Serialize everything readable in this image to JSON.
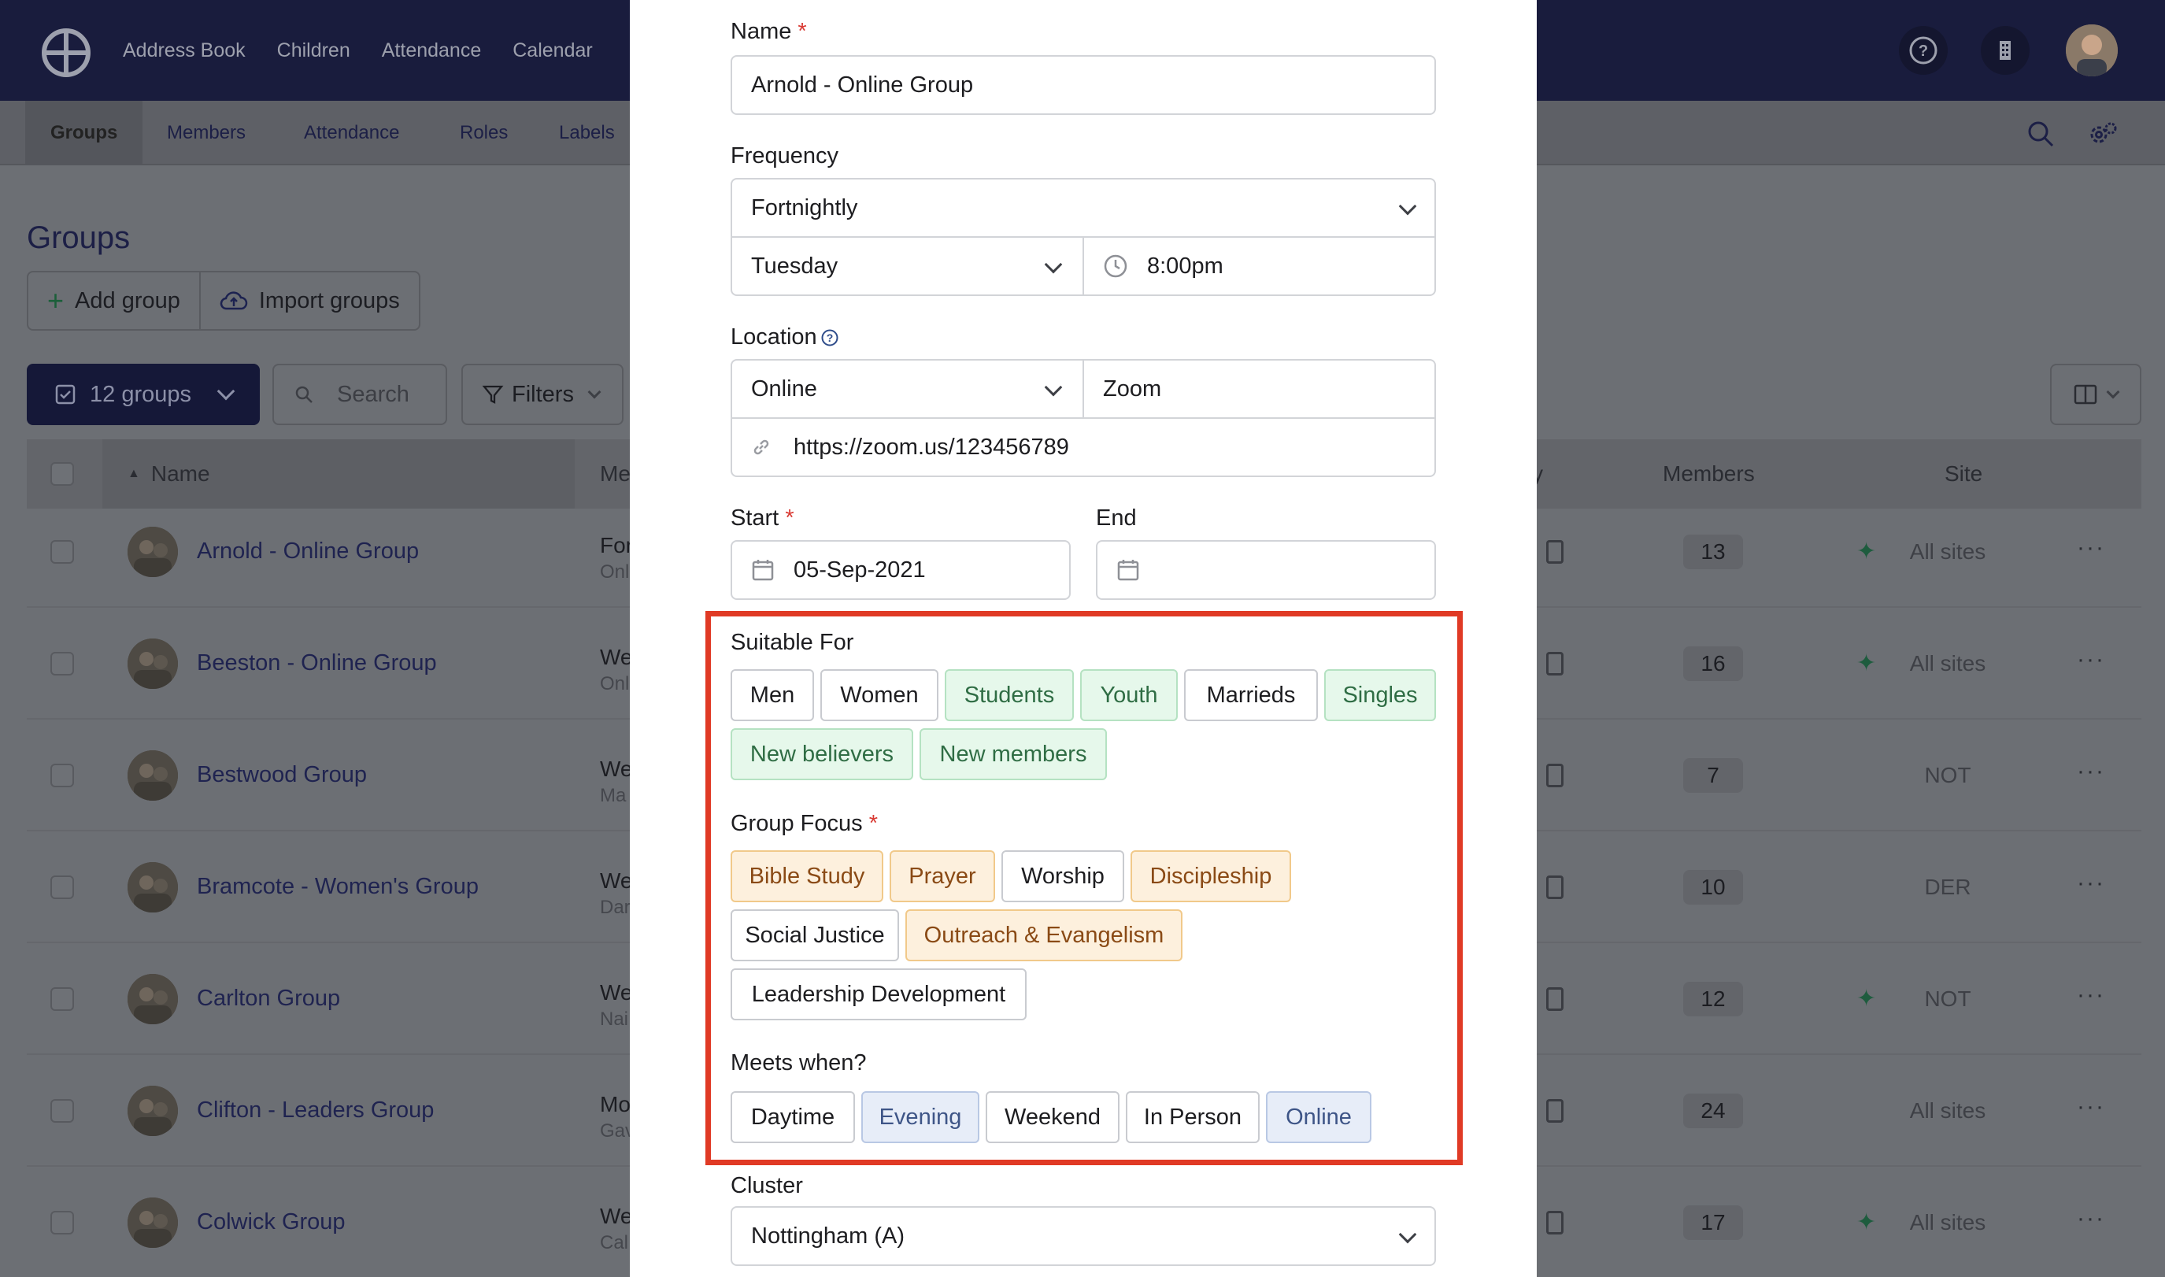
{
  "topnav": {
    "items": [
      "Address Book",
      "Children",
      "Attendance",
      "Calendar"
    ]
  },
  "subnav": {
    "tabs": [
      "Groups",
      "Members",
      "Attendance",
      "Roles",
      "Labels"
    ]
  },
  "page": {
    "title": "Groups",
    "add_group": "Add group",
    "import_groups": "Import groups",
    "groups_count": "12 groups",
    "search_placeholder": "Search",
    "filters": "Filters"
  },
  "table": {
    "headers": {
      "name": "Name",
      "meets": "Me",
      "activity": "y",
      "members": "Members",
      "site": "Site"
    },
    "rows": [
      {
        "name": "Arnold - Online Group",
        "meet1": "For",
        "meet2": "Onl",
        "members": "13",
        "site": "All sites",
        "spark": true
      },
      {
        "name": "Beeston - Online Group",
        "meet1": "We",
        "meet2": "Onl",
        "members": "16",
        "site": "All sites",
        "spark": true
      },
      {
        "name": "Bestwood Group",
        "meet1": "We",
        "meet2": "Ma",
        "members": "7",
        "site": "NOT",
        "spark": false
      },
      {
        "name": "Bramcote - Women's Group",
        "meet1": "We",
        "meet2": "Dar",
        "members": "10",
        "site": "DER",
        "spark": false
      },
      {
        "name": "Carlton Group",
        "meet1": "We",
        "meet2": "Nai",
        "members": "12",
        "site": "NOT",
        "spark": true
      },
      {
        "name": "Clifton - Leaders Group",
        "meet1": "Mo",
        "meet2": "Gav",
        "members": "24",
        "site": "All sites",
        "spark": false
      },
      {
        "name": "Colwick Group",
        "meet1": "We",
        "meet2": "Cal",
        "members": "17",
        "site": "All sites",
        "spark": true
      }
    ],
    "dots": "···"
  },
  "form": {
    "name_label": "Name",
    "name_value": "Arnold - Online Group",
    "frequency_label": "Frequency",
    "frequency_value": "Fortnightly",
    "day_value": "Tuesday",
    "time_value": "8:00pm",
    "location_label": "Location",
    "location_type": "Online",
    "location_platform": "Zoom",
    "location_url": "https://zoom.us/123456789",
    "start_label": "Start",
    "start_value": "05-Sep-2021",
    "end_label": "End",
    "end_value": "",
    "required_mark": "*",
    "suitable_label": "Suitable For",
    "suitable": [
      "Men",
      "Women",
      "Students",
      "Youth",
      "Marrieds",
      "Singles",
      "New believers",
      "New members"
    ],
    "focus_label": "Group Focus",
    "focus": [
      "Bible Study",
      "Prayer",
      "Worship",
      "Discipleship",
      "Social Justice",
      "Outreach & Evangelism",
      "Leadership Development"
    ],
    "meets_label": "Meets when?",
    "meets": [
      "Daytime",
      "Evening",
      "Weekend",
      "In Person",
      "Online"
    ],
    "cluster_label": "Cluster",
    "cluster_value": "Nottingham (A)"
  }
}
